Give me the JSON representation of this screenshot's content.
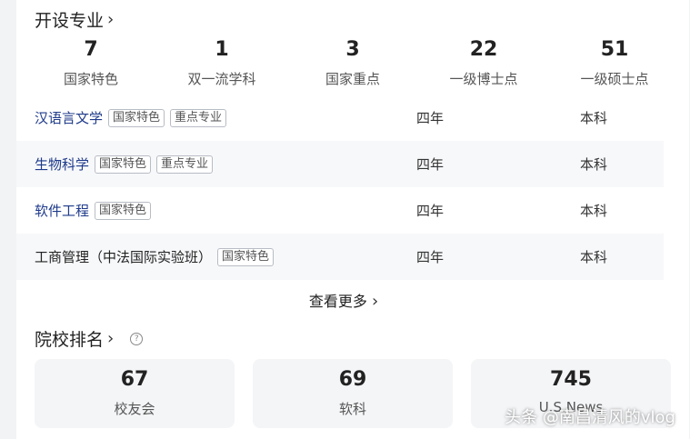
{
  "majors_section": {
    "title": "开设专业",
    "stats": [
      {
        "value": "7",
        "label": "国家特色"
      },
      {
        "value": "1",
        "label": "双一流学科"
      },
      {
        "value": "3",
        "label": "国家重点"
      },
      {
        "value": "22",
        "label": "一级博士点"
      },
      {
        "value": "51",
        "label": "一级硕士点"
      }
    ],
    "rows": [
      {
        "name": "汉语言文学",
        "tags": [
          "国家特色",
          "重点专业"
        ],
        "duration": "四年",
        "degree": "本科"
      },
      {
        "name": "生物科学",
        "tags": [
          "国家特色",
          "重点专业"
        ],
        "duration": "四年",
        "degree": "本科"
      },
      {
        "name": "软件工程",
        "tags": [
          "国家特色"
        ],
        "duration": "四年",
        "degree": "本科"
      },
      {
        "name": "工商管理（中法国际实验班）",
        "tags": [
          "国家特色"
        ],
        "duration": "四年",
        "degree": "本科"
      }
    ],
    "more_label": "查看更多"
  },
  "ranking_section": {
    "title": "院校排名",
    "help_icon": "?",
    "boxes": [
      {
        "value": "67",
        "label": "校友会"
      },
      {
        "value": "69",
        "label": "软科"
      },
      {
        "value": "745",
        "label": "U.S.News"
      }
    ]
  },
  "watermark": "头条 @南昌清风的vlog"
}
